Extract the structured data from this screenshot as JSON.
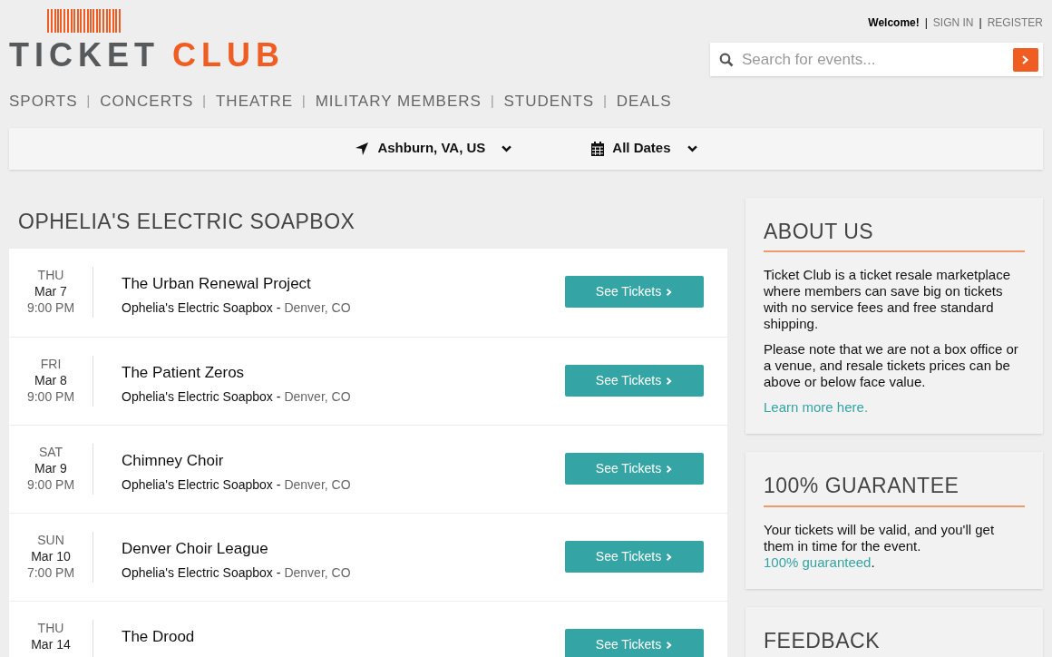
{
  "logo": {
    "word_1": "TICKET",
    "word_2": "CLUB"
  },
  "account": {
    "welcome": "Welcome!",
    "links": [
      {
        "kind": "separator",
        "label": "|"
      },
      {
        "kind": "link",
        "label": "SIGN IN"
      },
      {
        "kind": "separator",
        "label": "|"
      },
      {
        "kind": "link",
        "label": "REGISTER"
      }
    ]
  },
  "search": {
    "placeholder": "Search for events..."
  },
  "nav": [
    {
      "kind": "link",
      "label": "SPORTS"
    },
    {
      "kind": "separator",
      "label": "|"
    },
    {
      "kind": "link",
      "label": "CONCERTS"
    },
    {
      "kind": "separator",
      "label": "|"
    },
    {
      "kind": "link",
      "label": "THEATRE"
    },
    {
      "kind": "separator",
      "label": "|"
    },
    {
      "kind": "link",
      "label": "MILITARY MEMBERS"
    },
    {
      "kind": "separator",
      "label": "|"
    },
    {
      "kind": "link",
      "label": "STUDENTS"
    },
    {
      "kind": "separator",
      "label": "|"
    },
    {
      "kind": "link",
      "label": "DEALS"
    }
  ],
  "filters": [
    {
      "kind": "location",
      "label": "Ashburn, VA, US"
    },
    {
      "kind": "dates",
      "label": "All Dates"
    }
  ],
  "venue_title": "OPHELIA'S ELECTRIC SOAPBOX",
  "events": [
    {
      "day": "THU",
      "date": "Mar 7",
      "time": "9:00 PM",
      "name": "The Urban Renewal Project",
      "venue": "Ophelia's Electric Soapbox -",
      "city": "Denver, CO",
      "button": "See Tickets"
    },
    {
      "day": "FRI",
      "date": "Mar 8",
      "time": "9:00 PM",
      "name": "The Patient Zeros",
      "venue": "Ophelia's Electric Soapbox -",
      "city": "Denver, CO",
      "button": "See Tickets"
    },
    {
      "day": "SAT",
      "date": "Mar 9",
      "time": "9:00 PM",
      "name": "Chimney Choir",
      "venue": "Ophelia's Electric Soapbox -",
      "city": "Denver, CO",
      "button": "See Tickets"
    },
    {
      "day": "SUN",
      "date": "Mar 10",
      "time": "7:00 PM",
      "name": "Denver Choir League",
      "venue": "Ophelia's Electric Soapbox -",
      "city": "Denver, CO",
      "button": "See Tickets"
    },
    {
      "day": "THU",
      "date": "Mar 14",
      "name": "The Drood",
      "button": "See Tickets"
    }
  ],
  "sidebar": [
    {
      "title": "ABOUT US",
      "paragraphs": [
        "Ticket Club is a ticket resale marketplace where members can save big on tickets with no service fees and free standard shipping.",
        "Please note that we are not a box office or a venue, and resale tickets prices can be above or below face value."
      ],
      "link": "Learn more here."
    },
    {
      "title": "100% GUARANTEE",
      "text": "Your tickets will be valid, and you'll get them in time for the event.",
      "inline_link": "100% guaranteed",
      "text_end": "."
    },
    {
      "title": "FEEDBACK"
    }
  ]
}
